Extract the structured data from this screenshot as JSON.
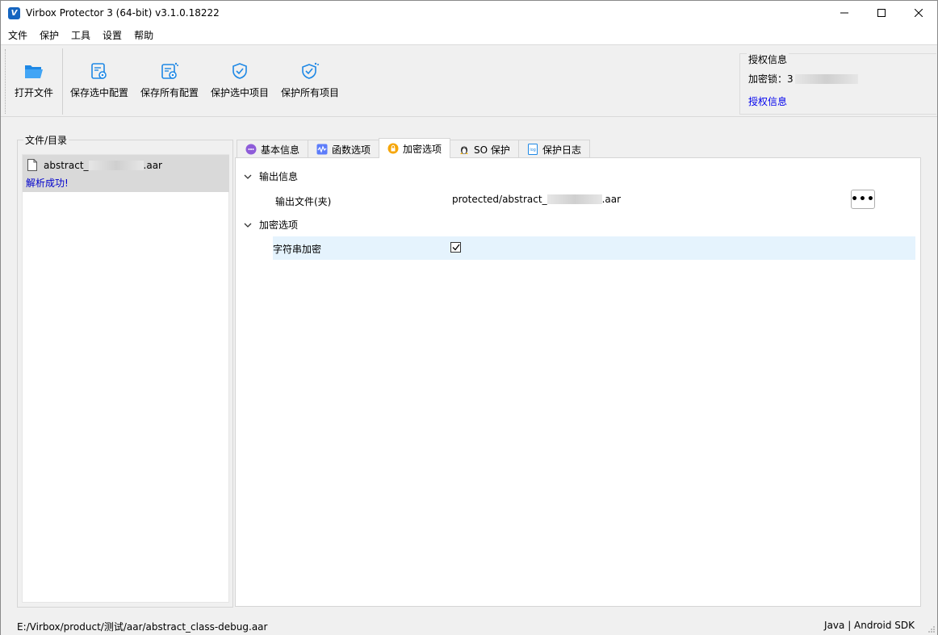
{
  "window": {
    "title": "Virbox Protector 3 (64-bit) v3.1.0.18222",
    "logo_letter": "V"
  },
  "menu": [
    {
      "label": "文件"
    },
    {
      "label": "保护"
    },
    {
      "label": "工具"
    },
    {
      "label": "设置"
    },
    {
      "label": "帮助"
    }
  ],
  "toolbar": {
    "open_file": "打开文件",
    "save_selected_config": "保存选中配置",
    "save_all_config": "保存所有配置",
    "protect_selected": "保护选中项目",
    "protect_all": "保护所有项目"
  },
  "license": {
    "group_title": "授权信息",
    "lock_label": "加密锁：",
    "lock_value_visible": "3",
    "link": "授权信息"
  },
  "file_panel": {
    "title": "文件/目录",
    "file_name_prefix": "abstract_",
    "file_name_suffix": ".aar",
    "status": "解析成功!"
  },
  "tabs": [
    {
      "label": "基本信息",
      "icon": "message-icon"
    },
    {
      "label": "函数选项",
      "icon": "function-icon"
    },
    {
      "label": "加密选项",
      "icon": "lock-icon",
      "active": true
    },
    {
      "label": "SO 保护",
      "icon": "linux-penguin-icon"
    },
    {
      "label": "保护日志",
      "icon": "log-icon"
    }
  ],
  "encrypt_options": {
    "output_section": "输出信息",
    "output_file_label": "输出文件(夹)",
    "output_file_prefix": "protected/abstract_",
    "output_file_suffix": ".aar",
    "more_button": "•••",
    "encrypt_section": "加密选项",
    "string_encrypt_label": "字符串加密",
    "string_encrypt_checked": true
  },
  "statusbar": {
    "path": "E:/Virbox/product/测试/aar/abstract_class-debug.aar",
    "platform": "Java | Android SDK"
  },
  "colors": {
    "accent_blue": "#1e88e5",
    "link": "#0000ee",
    "highlight_row": "#e5f3fd",
    "selected_item": "#d9d9d9"
  }
}
